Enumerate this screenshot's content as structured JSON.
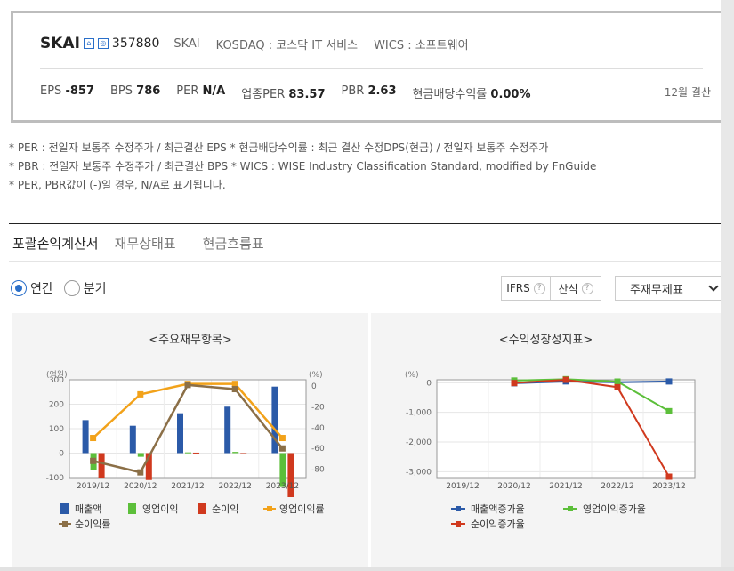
{
  "company": {
    "ticker": "SKAI",
    "badge1": "⌂",
    "badge2": "◎",
    "code": "357880",
    "short_name": "SKAI",
    "market": "KOSDAQ : 코스닥 IT 서비스",
    "wics": "WICS : 소프트웨어"
  },
  "ratios": [
    {
      "label": "EPS",
      "value": "-857"
    },
    {
      "label": "BPS",
      "value": "786"
    },
    {
      "label": "PER",
      "value": "N/A"
    },
    {
      "label": "업종PER",
      "value": "83.57"
    },
    {
      "label": "PBR",
      "value": "2.63"
    },
    {
      "label": "현금배당수익률",
      "value": "0.00%"
    }
  ],
  "settlement": "12월 결산",
  "notes": [
    "* PER : 전일자 보통주 수정주가 / 최근결산 EPS * 현금배당수익률 : 최근 결산 수정DPS(현금) / 전일자 보통주 수정주가",
    "* PBR : 전일자 보통주 수정주가 / 최근결산 BPS * WICS : WISE Industry Classification Standard, modified by FnGuide",
    "* PER, PBR값이 (-)일 경우, N/A로 표기됩니다."
  ],
  "tabs": [
    "포괄손익계산서",
    "재무상태표",
    "현금흐름표"
  ],
  "period": {
    "annual": "연간",
    "quarter": "분기",
    "selected": "annual"
  },
  "controls": {
    "ifrs": "IFRS",
    "calc": "산식",
    "help": "?",
    "select": "주재무제표"
  },
  "colors": {
    "sales": "#2b5aa8",
    "op": "#5cbf3a",
    "net": "#d0391e",
    "op_rate": "#f2a21a",
    "net_rate": "#8b6f47"
  },
  "chart_data": [
    {
      "type": "bar",
      "title": "<주요재무항목>",
      "ylabel": "(억원)",
      "y2label": "(%)",
      "categories": [
        "2019/12",
        "2020/12",
        "2021/12",
        "2022/12",
        "2023/12"
      ],
      "ylim": [
        -100,
        300
      ],
      "yticks": [
        "300",
        "200",
        "100",
        "0",
        "-100"
      ],
      "y2lim": [
        -88,
        6
      ],
      "y2ticks": [
        "0",
        "-20",
        "-40",
        "-60",
        "-80"
      ],
      "series": [
        {
          "name": "매출액",
          "kind": "bar",
          "values": [
            135,
            112,
            163,
            190,
            272
          ]
        },
        {
          "name": "영업이익",
          "kind": "bar",
          "values": [
            -70,
            -15,
            3,
            5,
            -135
          ]
        },
        {
          "name": "순이익",
          "kind": "bar",
          "values": [
            -100,
            -110,
            2,
            -5,
            -180
          ]
        },
        {
          "name": "영업이익률",
          "kind": "line",
          "values": [
            -50,
            -8,
            2,
            2,
            -50
          ]
        },
        {
          "name": "순이익률",
          "kind": "line",
          "values": [
            -72,
            -83,
            1,
            -3,
            -60
          ]
        }
      ]
    },
    {
      "type": "line",
      "title": "<수익성장성지표>",
      "ylabel": "(%)",
      "categories": [
        "2019/12",
        "2020/12",
        "2021/12",
        "2022/12",
        "2023/12"
      ],
      "ylim": [
        -3200,
        100
      ],
      "yticks": [
        "0",
        "-1,000",
        "-2,000",
        "-3,000"
      ],
      "series": [
        {
          "name": "매출액증가율",
          "values": [
            null,
            -17,
            45,
            17,
            43
          ]
        },
        {
          "name": "영업이익증가율",
          "values": [
            null,
            75,
            120,
            40,
            -960
          ]
        },
        {
          "name": "순이익증가율",
          "values": [
            null,
            -10,
            100,
            -150,
            -3170
          ]
        }
      ]
    }
  ]
}
